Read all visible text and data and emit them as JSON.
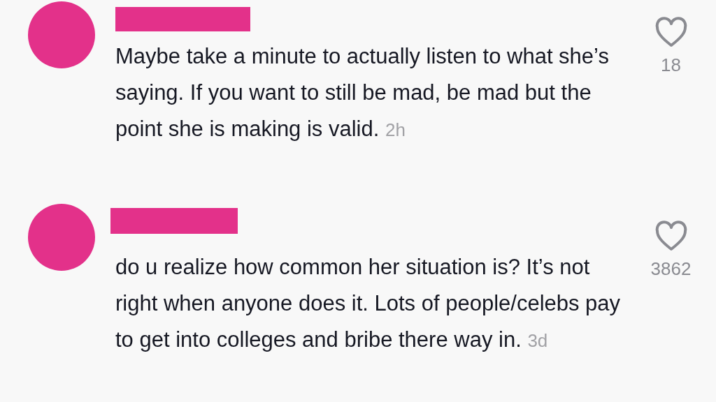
{
  "comments": [
    {
      "text": "Maybe take a minute to actually listen to what she’s saying. If you want to still be mad, be mad but the point she is making is valid.",
      "time": "2h",
      "likes": "18",
      "liked": false
    },
    {
      "text": "do u realize how common her situation is? It’s not right when anyone does it. Lots of people/celebs pay to get into colleges and bribe there way in.",
      "time": "3d",
      "likes": "3862",
      "liked": false
    }
  ]
}
